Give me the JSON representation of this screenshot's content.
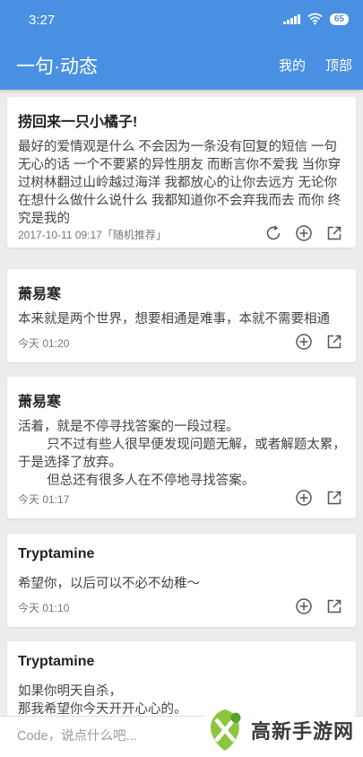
{
  "status_bar": {
    "time": "3:27",
    "battery": "65"
  },
  "app_bar": {
    "title": "一句·动态",
    "actions": [
      "我的",
      "顶部"
    ]
  },
  "posts": [
    {
      "title": "捞回来一只小橘子!",
      "body": "最好的爱情观是什么 不会因为一条没有回复的短信 一句无心的话 一个不要紧的异性朋友 而断言你不爱我 当你穿过树林翻过山岭越过海洋 我都放心的让你去远方 无论你在想什么做什么说什么 我都知道你不会弃我而去 而你 终究是我的",
      "meta": "2017-10-11 09:17「随机推荐」"
    },
    {
      "title": "萧易寒",
      "body": "本来就是两个世界，想要相通是难事，本就不需要相通",
      "meta": "今天 01:20"
    },
    {
      "title": "萧易寒",
      "body": "活着，就是不停寻找答案的一段过程。\n        只不过有些人很早便发现问题无解，或者解题太累，于是选择了放弃。\n        但总还有很多人在不停地寻找答案。",
      "meta": "今天 01:17"
    },
    {
      "title": "Tryptamine",
      "body": "希望你，以后可以不必不幼稚～",
      "meta": "今天 01:10"
    },
    {
      "title": "Tryptamine",
      "body": "如果你明天自杀，\n那我希望你今天开开心心的。",
      "meta": ""
    }
  ],
  "input_bar": {
    "placeholder": "Code，说点什么吧..."
  },
  "watermark": {
    "text": "高新手游网"
  },
  "icons": {
    "refresh": "refresh-icon",
    "add": "plus-circle-icon",
    "share": "share-icon"
  }
}
